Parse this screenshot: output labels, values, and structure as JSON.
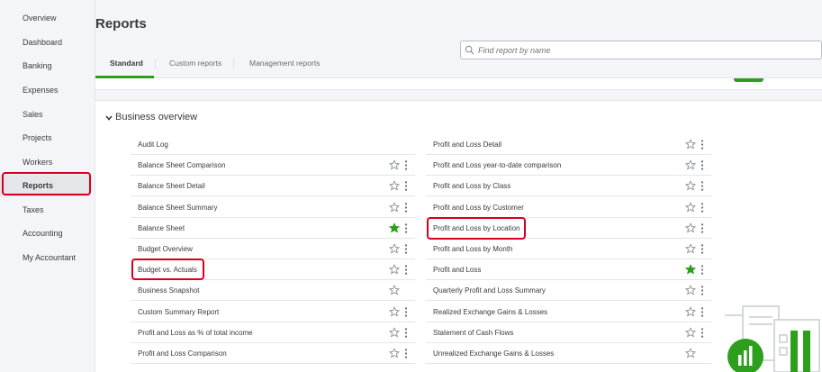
{
  "sidebar": {
    "items": [
      {
        "label": "Overview",
        "active": false
      },
      {
        "label": "Dashboard",
        "active": false
      },
      {
        "label": "Banking",
        "active": false
      },
      {
        "label": "Expenses",
        "active": false
      },
      {
        "label": "Sales",
        "active": false
      },
      {
        "label": "Projects",
        "active": false
      },
      {
        "label": "Workers",
        "active": false
      },
      {
        "label": "Reports",
        "active": true
      },
      {
        "label": "Taxes",
        "active": false
      },
      {
        "label": "Accounting",
        "active": false
      },
      {
        "label": "My Accountant",
        "active": false
      }
    ]
  },
  "header": {
    "title": "Reports",
    "search_placeholder": "Find report by name"
  },
  "tabs": [
    {
      "label": "Standard",
      "active": true
    },
    {
      "label": "Custom reports",
      "active": false
    },
    {
      "label": "Management reports",
      "active": false
    }
  ],
  "section": {
    "title": "Business overview"
  },
  "left_reports": [
    {
      "label": "Audit Log",
      "star": "none",
      "menu": false
    },
    {
      "label": "Balance Sheet Comparison",
      "star": "outline",
      "menu": true
    },
    {
      "label": "Balance Sheet Detail",
      "star": "outline",
      "menu": true
    },
    {
      "label": "Balance Sheet Summary",
      "star": "outline",
      "menu": true
    },
    {
      "label": "Balance Sheet",
      "star": "filled",
      "menu": true
    },
    {
      "label": "Budget Overview",
      "star": "outline",
      "menu": true
    },
    {
      "label": "Budget vs. Actuals",
      "star": "outline",
      "menu": true
    },
    {
      "label": "Business Snapshot",
      "star": "outline",
      "menu": false
    },
    {
      "label": "Custom Summary Report",
      "star": "outline",
      "menu": true
    },
    {
      "label": "Profit and Loss as % of total income",
      "star": "outline",
      "menu": true
    },
    {
      "label": "Profit and Loss Comparison",
      "star": "outline",
      "menu": true
    }
  ],
  "right_reports": [
    {
      "label": "Profit and Loss Detail",
      "star": "outline",
      "menu": true
    },
    {
      "label": "Profit and Loss year-to-date comparison",
      "star": "outline",
      "menu": true
    },
    {
      "label": "Profit and Loss by Class",
      "star": "outline",
      "menu": true
    },
    {
      "label": "Profit and Loss by Customer",
      "star": "outline",
      "menu": true
    },
    {
      "label": "Profit and Loss by Location",
      "star": "outline",
      "menu": true
    },
    {
      "label": "Profit and Loss by Month",
      "star": "outline",
      "menu": true
    },
    {
      "label": "Profit and Loss",
      "star": "filled",
      "menu": true
    },
    {
      "label": "Quarterly Profit and Loss Summary",
      "star": "outline",
      "menu": true
    },
    {
      "label": "Realized Exchange Gains & Losses",
      "star": "outline",
      "menu": true
    },
    {
      "label": "Statement of Cash Flows",
      "star": "outline",
      "menu": true
    },
    {
      "label": "Unrealized Exchange Gains & Losses",
      "star": "outline",
      "menu": false
    }
  ],
  "colors": {
    "accent_green": "#2ca01c",
    "highlight_red": "#d6001c",
    "star_outline": "#8d9096",
    "text": "#393a3d"
  }
}
